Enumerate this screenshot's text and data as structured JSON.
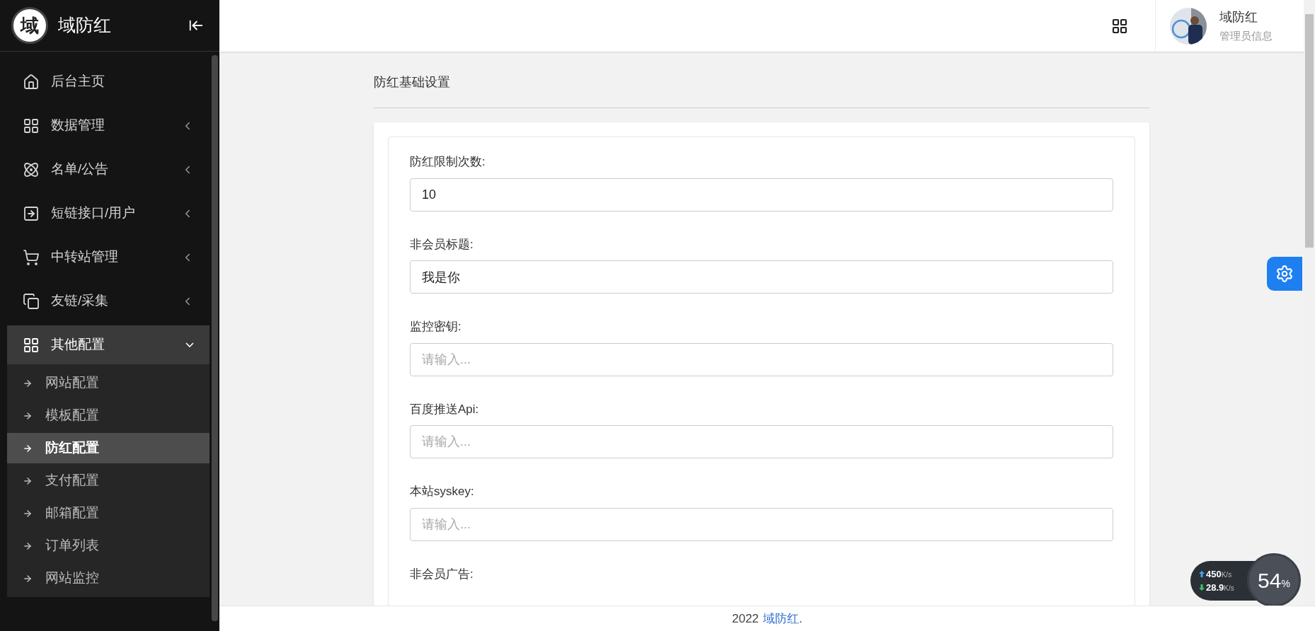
{
  "sidebar": {
    "logo_text": "域",
    "brand": "域防红",
    "menu": [
      {
        "label": "后台主页",
        "kind": "link"
      },
      {
        "label": "数据管理",
        "kind": "group",
        "expanded": false
      },
      {
        "label": "名单/公告",
        "kind": "group",
        "expanded": false
      },
      {
        "label": "短链接口/用户",
        "kind": "group",
        "expanded": false
      },
      {
        "label": "中转站管理",
        "kind": "group",
        "expanded": false
      },
      {
        "label": "友链/采集",
        "kind": "group",
        "expanded": false
      },
      {
        "label": "其他配置",
        "kind": "group",
        "expanded": true,
        "children": [
          {
            "label": "网站配置",
            "selected": false
          },
          {
            "label": "模板配置",
            "selected": false
          },
          {
            "label": "防红配置",
            "selected": true
          },
          {
            "label": "支付配置",
            "selected": false
          },
          {
            "label": "邮箱配置",
            "selected": false
          },
          {
            "label": "订单列表",
            "selected": false
          },
          {
            "label": "网站监控",
            "selected": false
          }
        ]
      }
    ]
  },
  "header": {
    "user_name": "域防红",
    "user_role": "管理员信息"
  },
  "main": {
    "title": "防红基础设置",
    "fields": [
      {
        "label": "防红限制次数:",
        "value": "10"
      },
      {
        "label": "非会员标题:",
        "value": "我是你"
      },
      {
        "label": "监控密钥:",
        "placeholder": "请输入..."
      },
      {
        "label": "百度推送Api:",
        "placeholder": "请输入..."
      },
      {
        "label": "本站syskey:",
        "placeholder": "请输入..."
      },
      {
        "label": "非会员广告:"
      }
    ]
  },
  "footer": {
    "year": "2022",
    "link": "域防红",
    "suffix": "."
  },
  "speed_widget": {
    "upload": "450",
    "upload_unit": "K/s",
    "download": "28.9",
    "download_unit": "K/s",
    "percent": "54",
    "percent_unit": "%"
  }
}
